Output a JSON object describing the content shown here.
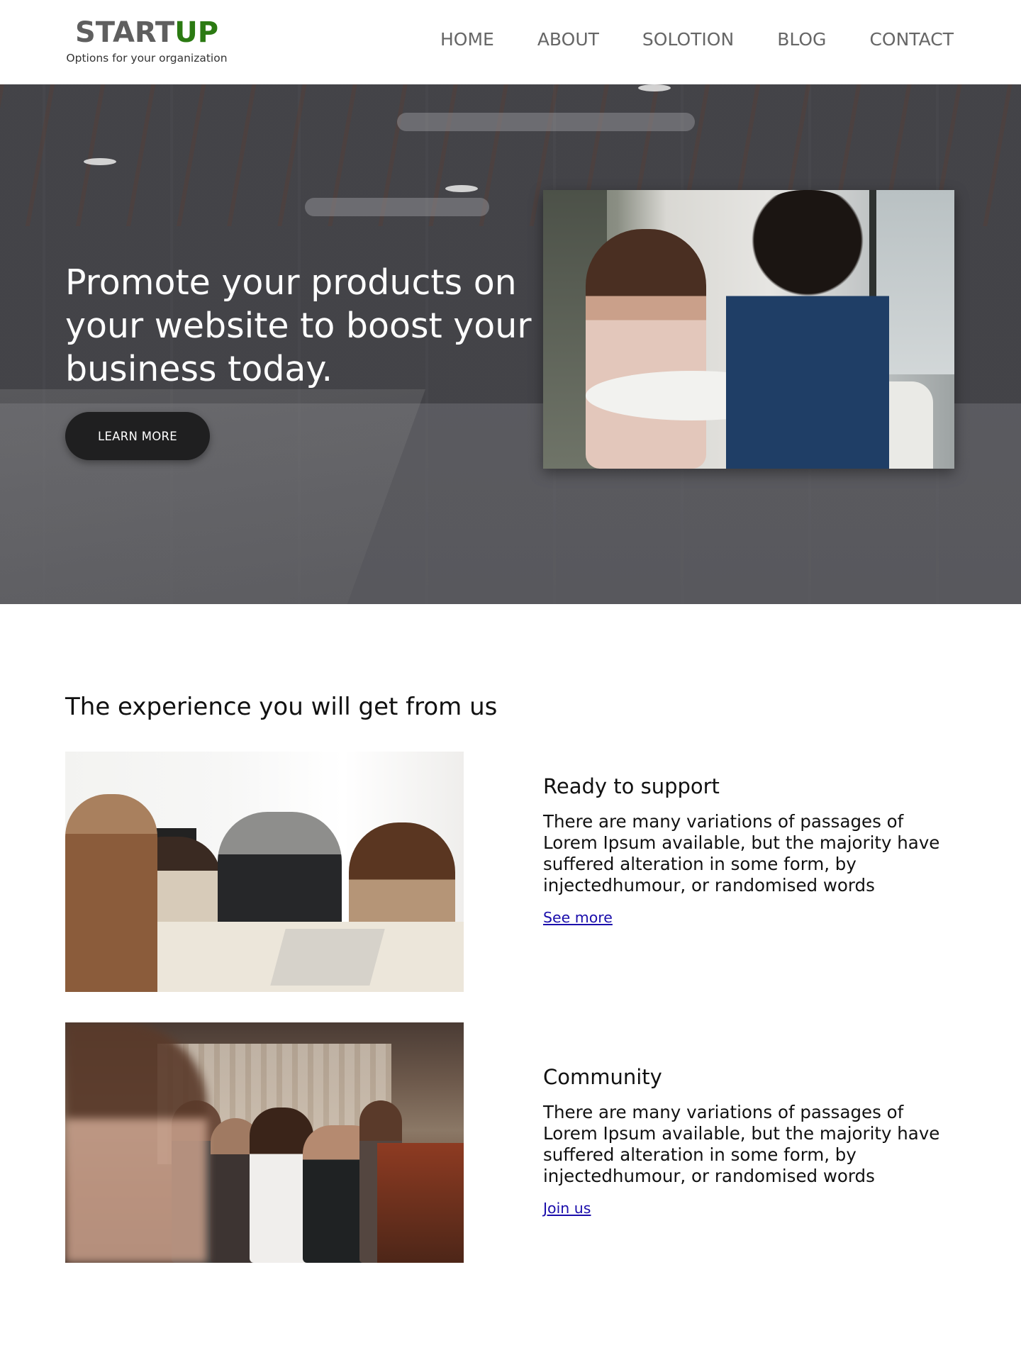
{
  "header": {
    "logo_start": "START",
    "logo_up": "UP",
    "tagline": "Options for your organization",
    "nav": [
      "HOME",
      "ABOUT",
      "SOLOTION",
      "BLOG",
      "CONTACT"
    ]
  },
  "hero": {
    "title": "Promote your products on your website to boost your business today.",
    "button_label": "LEARN MORE"
  },
  "experience": {
    "title": "The experience you will get from us",
    "cards": [
      {
        "heading": "Ready to support",
        "text": "There are many variations of passages of Lorem Ipsum available, but the majority have suffered alteration in some form, by injectedhumour, or randomised words",
        "link": "See more"
      },
      {
        "heading": "Community",
        "text": "There are many variations of passages of Lorem Ipsum available, but the majority have suffered alteration in some form, by injectedhumour, or randomised words",
        "link": "Join us"
      }
    ]
  },
  "colors": {
    "brand_gray": "#5f5f5f",
    "brand_green": "#2b7a12",
    "button_dark": "#1f1f20",
    "link_blue": "#1a0dab"
  }
}
